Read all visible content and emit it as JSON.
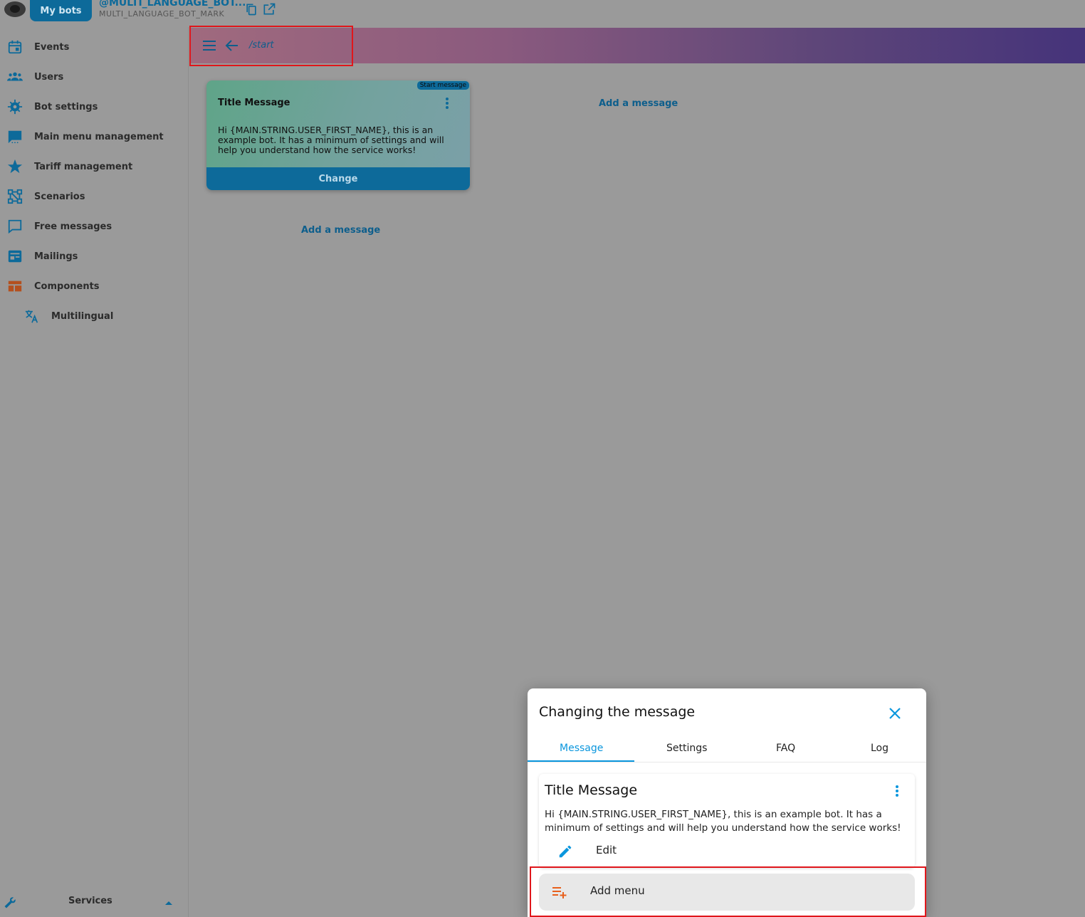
{
  "topbar": {
    "my_bots_label": "My bots",
    "bot_handle": "@MULTI_LANGUAGE_BOT...",
    "bot_mark": "MULTI_LANGUAGE_BOT_MARK",
    "icons": [
      "robot-logo-icon",
      "copy-icon",
      "open-external-icon"
    ]
  },
  "sidebar": {
    "items": [
      {
        "label": "Events",
        "icon": "calendar-icon",
        "color": "#0d6a9a"
      },
      {
        "label": "Users",
        "icon": "users-icon",
        "color": "#0d6a9a"
      },
      {
        "label": "Bot settings",
        "icon": "gear-icon",
        "color": "#0d6a9a"
      },
      {
        "label": "Main menu management",
        "icon": "chat-menu-icon",
        "color": "#0d6a9a"
      },
      {
        "label": "Tariff management",
        "icon": "star-icon",
        "color": "#0d6a9a"
      },
      {
        "label": "Scenarios",
        "icon": "scenario-graph-icon",
        "color": "#0d6a9a"
      },
      {
        "label": "Free messages",
        "icon": "chat-bubble-icon",
        "color": "#0d6a9a"
      },
      {
        "label": "Mailings",
        "icon": "newsletter-icon",
        "color": "#0d6a9a"
      },
      {
        "label": "Components",
        "icon": "components-icon",
        "color": "#b4501e"
      },
      {
        "label": "Multilingual",
        "icon": "translate-icon",
        "color": "#0d6a9a"
      }
    ],
    "services_label": "Services"
  },
  "header": {
    "path": "/start",
    "icons": [
      "hamburger-menu-icon",
      "arrow-left-icon"
    ]
  },
  "canvas": {
    "card": {
      "badge": "Start message",
      "title": "Title Message",
      "text": "Hi {MAIN.STRING.USER_FIRST_NAME}, this is an example bot. It has a minimum of settings and will help you understand how the service works!",
      "button_label": "Change"
    },
    "add_message_right": "Add a message",
    "add_message_below": "Add a message"
  },
  "dialog": {
    "title": "Changing the message",
    "tabs": [
      {
        "label": "Message",
        "active": true
      },
      {
        "label": "Settings",
        "active": false
      },
      {
        "label": "FAQ",
        "active": false
      },
      {
        "label": "Log",
        "active": false
      }
    ],
    "message": {
      "title": "Title Message",
      "text": "Hi {MAIN.STRING.USER_FIRST_NAME}, this is an example bot. It has a minimum of settings and will help you understand how the service works!",
      "edit_label": "Edit"
    },
    "add_menu_label": "Add menu",
    "accent_color": "#0a96dd"
  }
}
